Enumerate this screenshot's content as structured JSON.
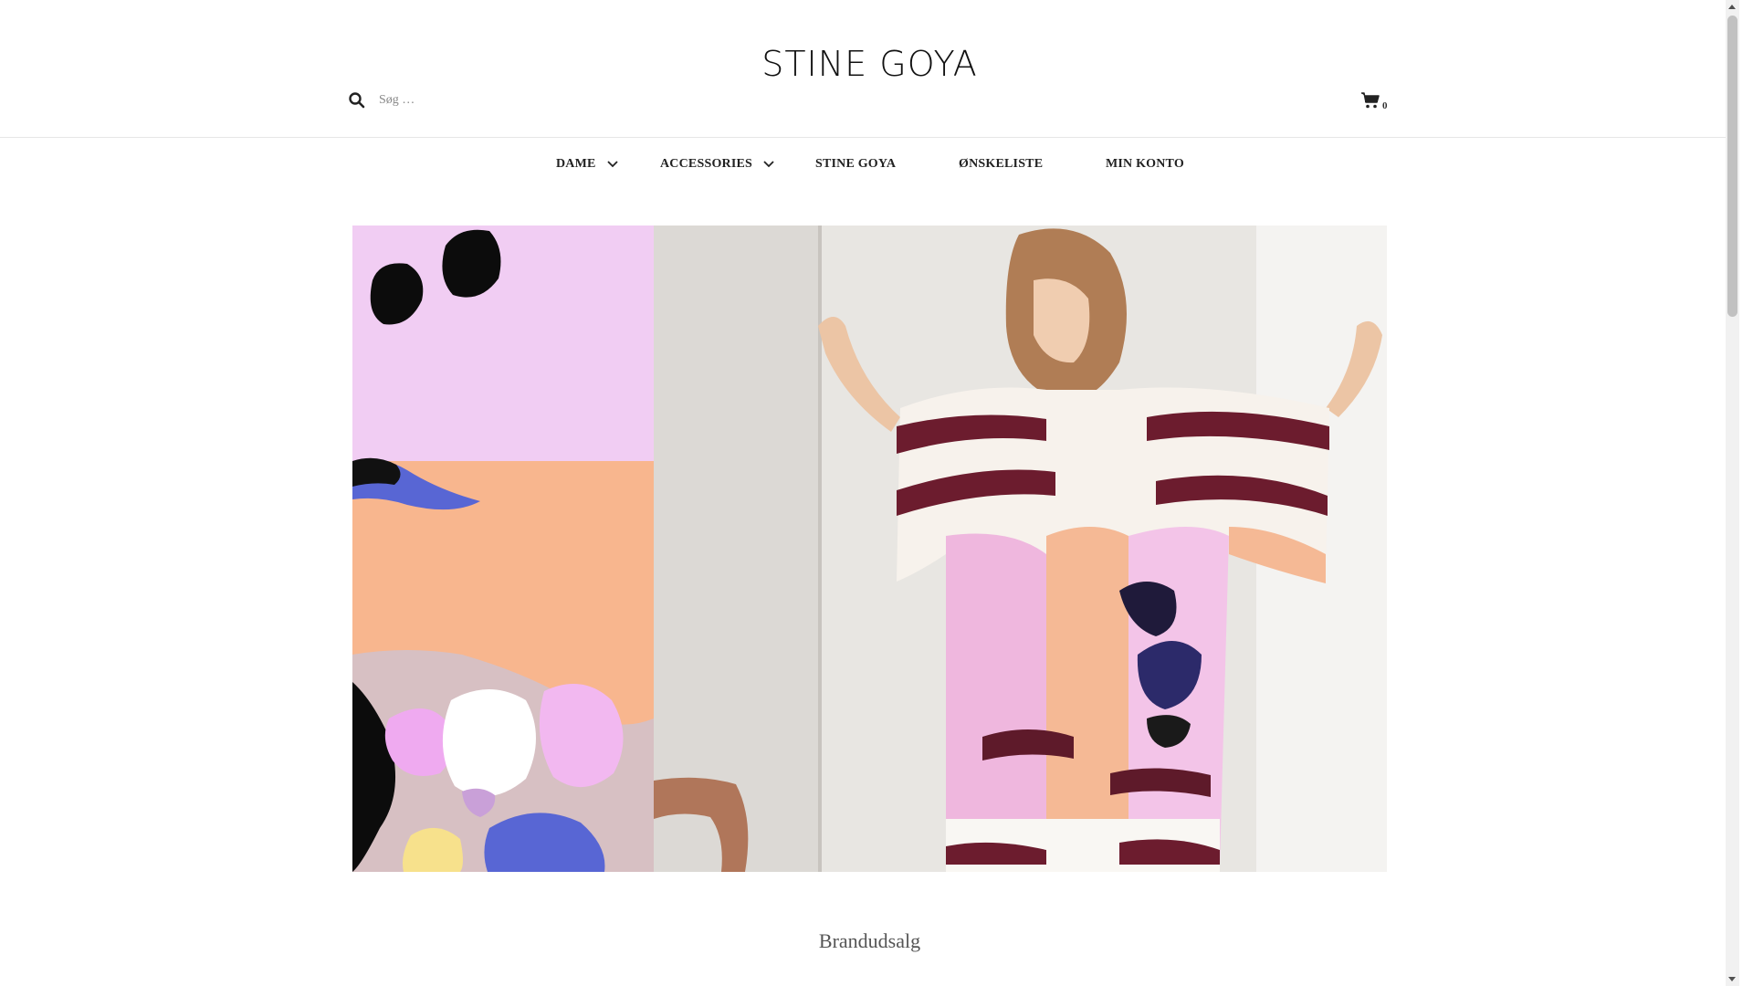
{
  "header": {
    "logo_text": "STINE GOYA",
    "search": {
      "placeholder": "Søg …",
      "value": ""
    },
    "cart": {
      "count": "0"
    }
  },
  "nav": {
    "items": [
      {
        "label": "DAME",
        "has_dropdown": true
      },
      {
        "label": "ACCESSORIES",
        "has_dropdown": true
      },
      {
        "label": "STINE GOYA",
        "has_dropdown": false
      },
      {
        "label": "ØNSKELISTE",
        "has_dropdown": false
      },
      {
        "label": "MIN KONTO",
        "has_dropdown": false
      }
    ]
  },
  "hero": {
    "caption": "Brandudsalg"
  },
  "icons": {
    "search": "search-icon",
    "cart": "cart-icon",
    "chevron": "chevron-down-icon"
  },
  "colors": {
    "text": "#222222",
    "divider": "#e6e6e6",
    "caption": "#555555",
    "art_pink": "#f0c8f0",
    "art_peach": "#f7b48c",
    "art_blue": "#5a6ad6",
    "art_maroon": "#6a1a2a"
  }
}
